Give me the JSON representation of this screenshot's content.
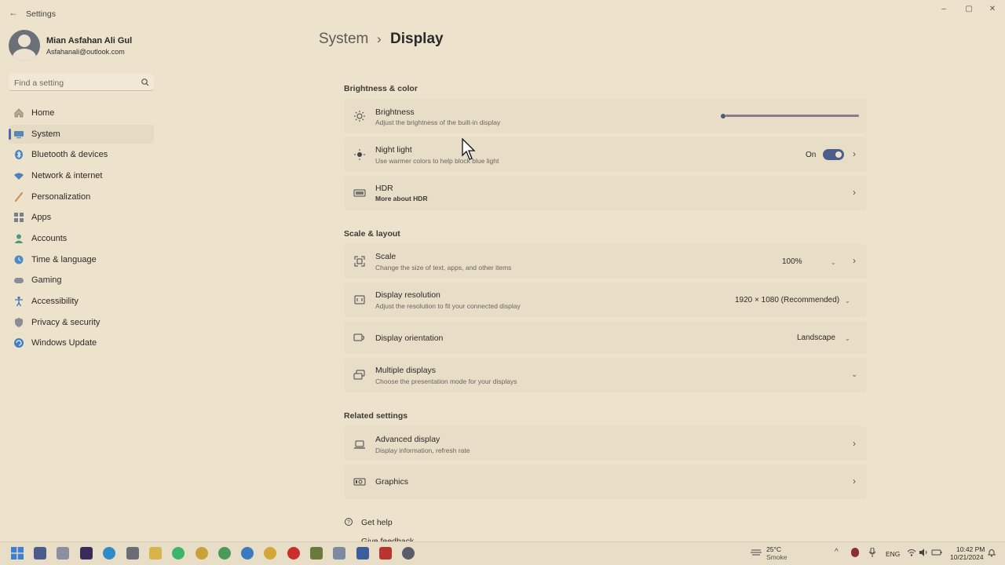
{
  "window": {
    "title": "Settings",
    "buttons": {
      "minimize": "–",
      "maximize": "▢",
      "close": "✕"
    }
  },
  "user": {
    "name": "Mian Asfahan Ali Gul",
    "email": "Asfahanali@outlook.com"
  },
  "search": {
    "placeholder": "Find a setting"
  },
  "sidebar": {
    "items": [
      {
        "label": "Home",
        "icon": "home-icon"
      },
      {
        "label": "System",
        "icon": "system-icon",
        "selected": true
      },
      {
        "label": "Bluetooth & devices",
        "icon": "bluetooth-icon"
      },
      {
        "label": "Network & internet",
        "icon": "network-icon"
      },
      {
        "label": "Personalization",
        "icon": "brush-icon"
      },
      {
        "label": "Apps",
        "icon": "apps-icon"
      },
      {
        "label": "Accounts",
        "icon": "accounts-icon"
      },
      {
        "label": "Time & language",
        "icon": "time-language-icon"
      },
      {
        "label": "Gaming",
        "icon": "gaming-icon"
      },
      {
        "label": "Accessibility",
        "icon": "accessibility-icon"
      },
      {
        "label": "Privacy & security",
        "icon": "shield-icon"
      },
      {
        "label": "Windows Update",
        "icon": "update-icon"
      }
    ]
  },
  "breadcrumb": {
    "root": "System",
    "separator": "›",
    "page": "Display"
  },
  "sections": {
    "brightness_color": {
      "title": "Brightness & color",
      "brightness": {
        "title": "Brightness",
        "subtitle": "Adjust the brightness of the built-in display",
        "level": 0
      },
      "night_light": {
        "title": "Night light",
        "subtitle": "Use warmer colors to help block blue light",
        "state": "On"
      },
      "hdr": {
        "title": "HDR",
        "subtitle": "More about HDR"
      }
    },
    "scale_layout": {
      "title": "Scale & layout",
      "scale": {
        "title": "Scale",
        "subtitle": "Change the size of text, apps, and other items",
        "value": "100%"
      },
      "resolution": {
        "title": "Display resolution",
        "subtitle": "Adjust the resolution to fit your connected display",
        "value": "1920 × 1080 (Recommended)"
      },
      "orientation": {
        "title": "Display orientation",
        "value": "Landscape"
      },
      "multiple": {
        "title": "Multiple displays",
        "subtitle": "Choose the presentation mode for your displays"
      }
    },
    "related": {
      "title": "Related settings",
      "advanced": {
        "title": "Advanced display",
        "subtitle": "Display information, refresh rate"
      },
      "graphics": {
        "title": "Graphics"
      }
    }
  },
  "help": {
    "get_help": "Get help",
    "give_feedback": "Give feedback"
  },
  "taskbar": {
    "weather": {
      "temp": "25°C",
      "condition": "Smoke"
    },
    "language": "ENG",
    "time": "10:42 PM",
    "date": "10/21/2024"
  },
  "colors": {
    "accent": "#4b5d8a",
    "background": "#ede3cd",
    "card": "#e8dec8"
  }
}
